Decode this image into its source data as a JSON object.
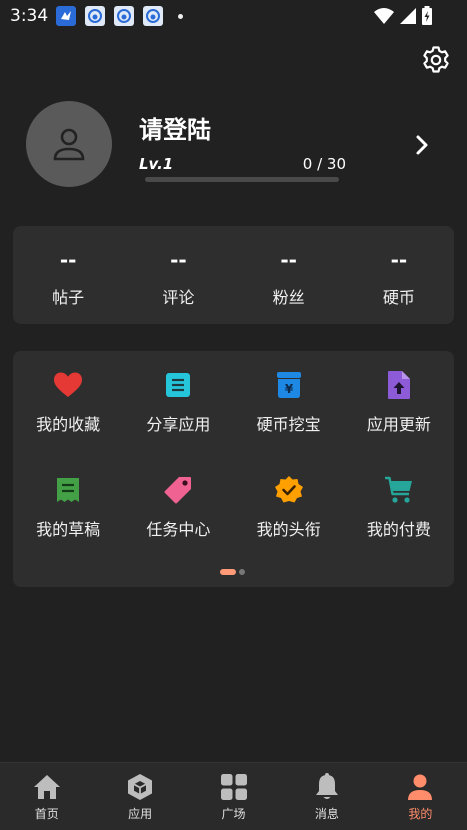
{
  "status_bar": {
    "time": "3:34"
  },
  "profile": {
    "title": "请登陆",
    "level": "Lv.1",
    "exp_text": "0 / 30",
    "exp_progress": 0.0
  },
  "stats": [
    {
      "value": "--",
      "label": "帖子"
    },
    {
      "value": "--",
      "label": "评论"
    },
    {
      "value": "--",
      "label": "粉丝"
    },
    {
      "value": "--",
      "label": "硬币"
    }
  ],
  "features": [
    {
      "label": "我的收藏",
      "icon": "heart-icon",
      "color": "#e53935"
    },
    {
      "label": "分享应用",
      "icon": "list-icon",
      "color": "#26c6da"
    },
    {
      "label": "硬币挖宝",
      "icon": "coin-bag-icon",
      "color": "#1e88e5"
    },
    {
      "label": "应用更新",
      "icon": "file-upload-icon",
      "color": "#8e5bd8"
    },
    {
      "label": "我的草稿",
      "icon": "receipt-icon",
      "color": "#43a047"
    },
    {
      "label": "任务中心",
      "icon": "tag-icon",
      "color": "#f06292"
    },
    {
      "label": "我的头衔",
      "icon": "badge-check-icon",
      "color": "#ffa000"
    },
    {
      "label": "我的付费",
      "icon": "cart-icon",
      "color": "#26a69a"
    }
  ],
  "bottom_nav": [
    {
      "label": "首页",
      "icon": "home-icon",
      "active": false
    },
    {
      "label": "应用",
      "icon": "cube-icon",
      "active": false
    },
    {
      "label": "广场",
      "icon": "grid-icon",
      "active": false
    },
    {
      "label": "消息",
      "icon": "bell-icon",
      "active": false
    },
    {
      "label": "我的",
      "icon": "person-icon",
      "active": true
    }
  ],
  "colors": {
    "background": "#212121",
    "card": "#2e2e2e",
    "accent": "#ff8c6b"
  }
}
